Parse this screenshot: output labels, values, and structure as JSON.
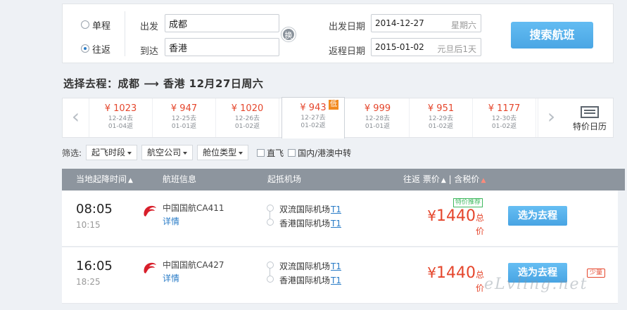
{
  "search": {
    "one_way_label": "单程",
    "round_trip_label": "往返",
    "from_label": "出发",
    "to_label": "到达",
    "from_city": "成都",
    "to_city": "香港",
    "swap_label": "换",
    "depart_date_label": "出发日期",
    "depart_date": "2014-12-27",
    "depart_note": "星期六",
    "return_date_label": "返程日期",
    "return_date": "2015-01-02",
    "return_note": "元旦后1天",
    "search_button": "搜索航班"
  },
  "route_title": "选择去程：成都 ⟶ 香港  12月27日周六",
  "date_strip": {
    "days": [
      {
        "price": "¥ 1023",
        "dep": "12-24去",
        "ret": "01-04返"
      },
      {
        "price": "¥ 947",
        "dep": "12-25去",
        "ret": "01-01返"
      },
      {
        "price": "¥ 1020",
        "dep": "12-26去",
        "ret": "01-02返"
      },
      {
        "price": "¥ 943",
        "dep": "12-27去",
        "ret": "01-02返",
        "tag": "低"
      },
      {
        "price": "¥ 999",
        "dep": "12-28去",
        "ret": "01-01返"
      },
      {
        "price": "¥ 951",
        "dep": "12-29去",
        "ret": "01-02返"
      },
      {
        "price": "¥ 1177",
        "dep": "12-30去",
        "ret": "01-02返"
      }
    ],
    "selected_index": 3,
    "calendar_label": "特价日历"
  },
  "filters": {
    "label": "筛选:",
    "time": "起飞时段",
    "airline": "航空公司",
    "cabin": "舱位类型",
    "direct": "直飞",
    "transit": "国内/港澳中转"
  },
  "table": {
    "col_time": "当地起降时间",
    "col_flight": "航班信息",
    "col_airport": "起抵机场",
    "col_price": "往返 票价",
    "col_tax": "含税价"
  },
  "flights": [
    {
      "dep": "08:05",
      "arr": "10:15",
      "airline": "中国国航",
      "code": "CA411",
      "detail": "详情",
      "from_ap": "双流国际机场",
      "from_t": "T1",
      "to_ap": "香港国际机场",
      "to_t": "T1",
      "promo": "特价推荐",
      "currency": "¥",
      "price": "1440",
      "unit": "总价",
      "select": "选为去程"
    },
    {
      "dep": "16:05",
      "arr": "18:25",
      "airline": "中国国航",
      "code": "CA427",
      "detail": "详情",
      "from_ap": "双流国际机场",
      "from_t": "T1",
      "to_ap": "香港国际机场",
      "to_t": "T1",
      "currency": "¥",
      "price": "1440",
      "unit": "总价",
      "select": "选为去程",
      "badge": "少量"
    }
  ],
  "watermark": "eLvling.net",
  "colors": {
    "accent": "#55b1ec",
    "price": "#e5462c",
    "header": "#8d959e",
    "promo": "#3eb85e",
    "low": "#f28a1e"
  }
}
